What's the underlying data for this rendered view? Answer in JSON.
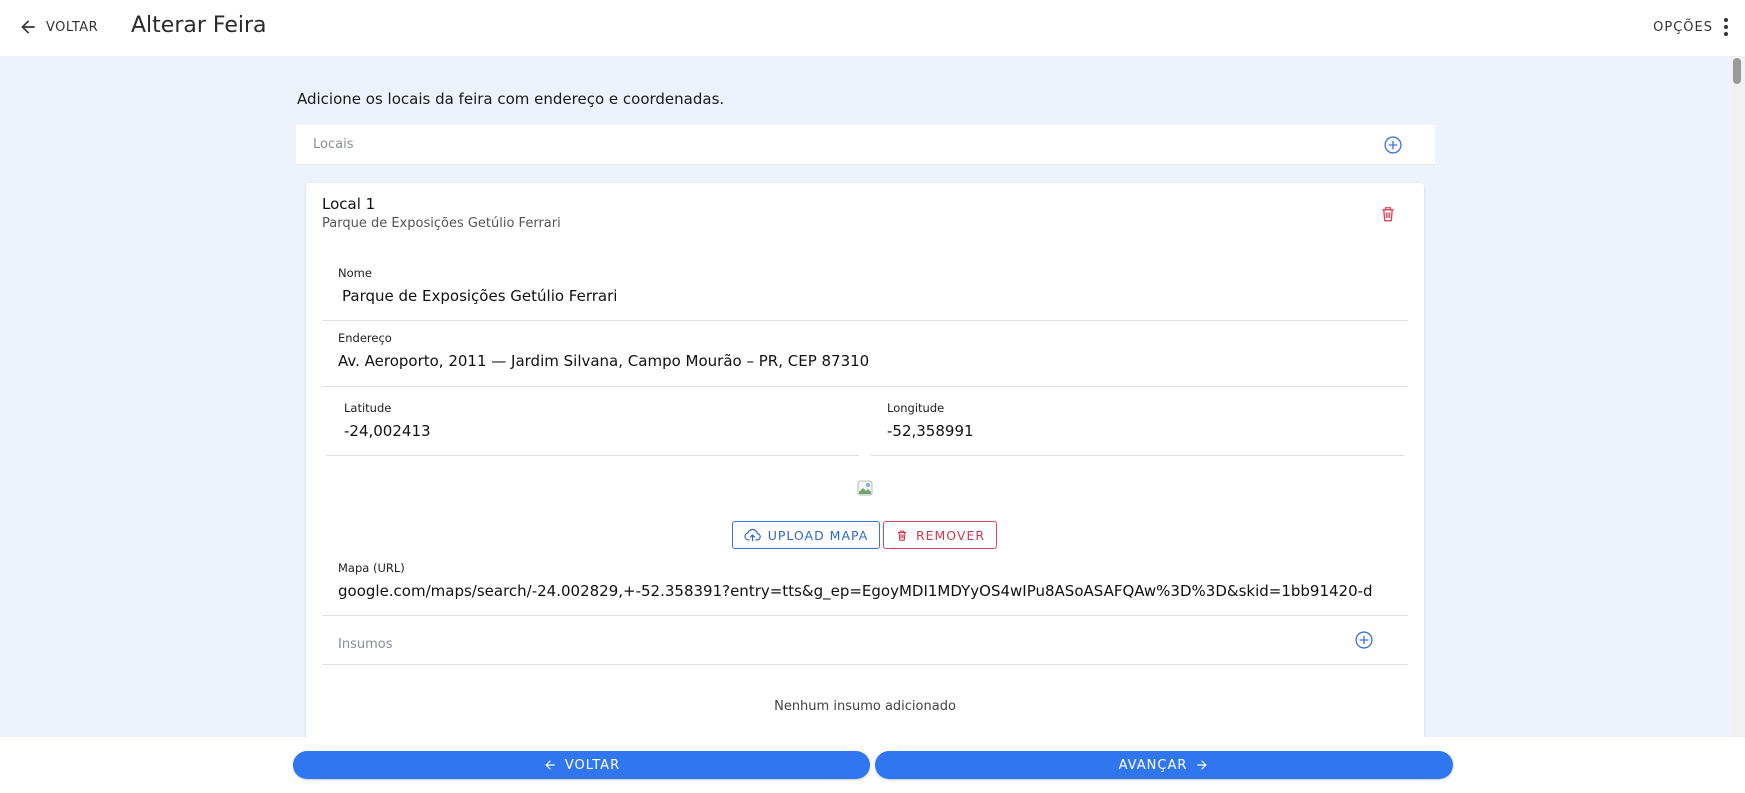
{
  "header": {
    "back_label": "VOLTAR",
    "title": "Alterar Feira",
    "options_label": "OPÇÕES"
  },
  "intro_text": "Adicione os locais da feira com endereço e coordenadas.",
  "locais": {
    "label": "Locais",
    "items": [
      {
        "title": "Local 1",
        "subtitle": "Parque de Exposições Getúlio Ferrari",
        "nome_label": "Nome",
        "nome_value": "Parque de Exposições Getúlio Ferrari",
        "endereco_label": "Endereço",
        "endereco_value": "Av. Aeroporto, 2011 — Jardim Silvana, Campo Mourão – PR, CEP 87310",
        "latitude_label": "Latitude",
        "latitude_value": "-24,002413",
        "longitude_label": "Longitude",
        "longitude_value": "-52,358991",
        "upload_label": "UPLOAD MAPA",
        "remove_label": "REMOVER",
        "mapa_label": "Mapa (URL)",
        "mapa_value": "google.com/maps/search/-24.002829,+-52.358391?entry=tts&g_ep=EgoyMDI1MDYyOS4wIPu8ASoASAFQAw%3D%3D&skid=1bb91420-d",
        "insumos_label": "Insumos",
        "insumos_empty": "Nenhum insumo adicionado"
      }
    ]
  },
  "footer": {
    "back_label": "VOLTAR",
    "next_label": "AVANÇAR"
  },
  "colors": {
    "primary": "#2f76f0",
    "danger": "#d9455a",
    "background": "#eef3fb"
  },
  "icons": [
    "arrow-left-icon",
    "more-vert-icon",
    "plus-circle-icon",
    "trash-icon",
    "cloud-upload-icon",
    "arrow-right-icon",
    "broken-image-icon"
  ]
}
